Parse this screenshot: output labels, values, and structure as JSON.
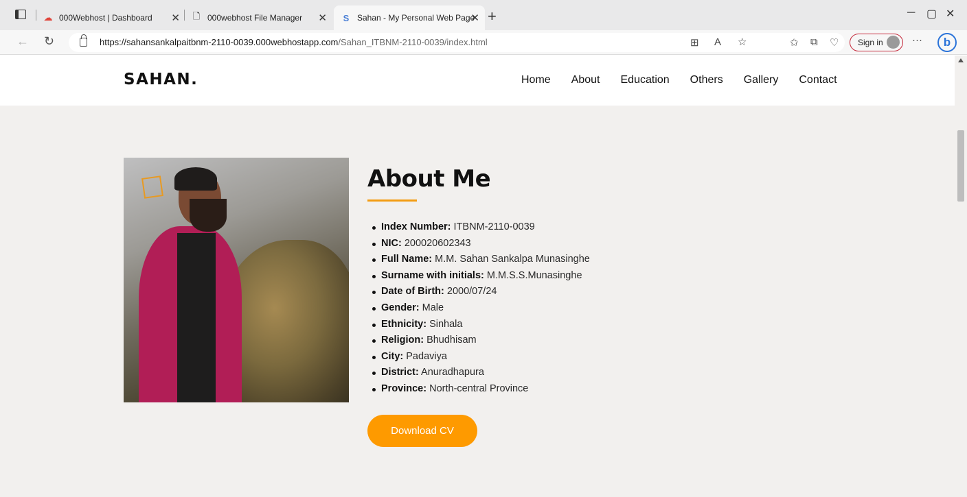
{
  "browser": {
    "tabs": [
      {
        "title": "000Webhost | Dashboard",
        "favicon": "webhost-icon"
      },
      {
        "title": "000webhost File Manager",
        "favicon": "file-icon"
      },
      {
        "title": "Sahan - My Personal Web Page",
        "favicon": "s-icon",
        "active": true
      }
    ],
    "url_host": "https://sahansankalpaitbnm-2110-0039.000webhostapp.com",
    "url_path": "/Sahan_ITBNM-2110-0039/index.html",
    "sign_in_label": "Sign in",
    "accent_color": "#c4283a"
  },
  "site": {
    "logo": "SAHAN.",
    "nav": [
      "Home",
      "About",
      "Education",
      "Others",
      "Gallery",
      "Contact"
    ]
  },
  "about": {
    "heading": "About Me",
    "accent_color": "#f39c12",
    "facts": [
      {
        "label": "Index Number:",
        "value": "ITBNM-2110-0039"
      },
      {
        "label": "NIC:",
        "value": "200020602343"
      },
      {
        "label": "Full Name:",
        "value": "M.M. Sahan Sankalpa Munasinghe"
      },
      {
        "label": "Surname with initials:",
        "value": "M.M.S.S.Munasinghe"
      },
      {
        "label": "Date of Birth:",
        "value": "2000/07/24"
      },
      {
        "label": "Gender:",
        "value": "Male"
      },
      {
        "label": "Ethnicity:",
        "value": "Sinhala"
      },
      {
        "label": "Religion:",
        "value": "Bhudhisam"
      },
      {
        "label": "City:",
        "value": "Padaviya"
      },
      {
        "label": "District:",
        "value": "Anuradhapura"
      },
      {
        "label": "Province:",
        "value": "North-central Province"
      }
    ],
    "cv_button": "Download CV",
    "cv_button_color": "#fe9a00"
  }
}
